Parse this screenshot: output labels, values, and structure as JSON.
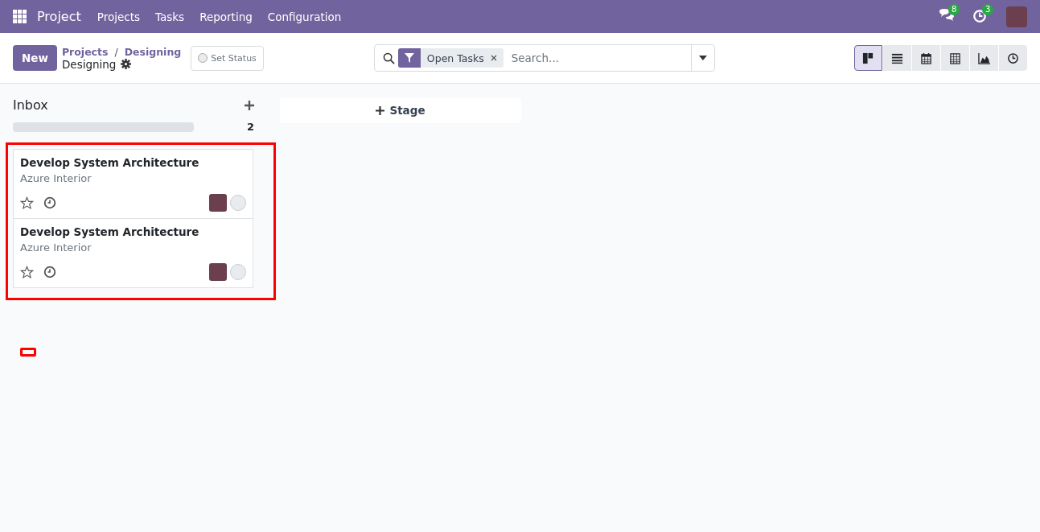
{
  "navbar": {
    "app_name": "Project",
    "menu": [
      "Projects",
      "Tasks",
      "Reporting",
      "Configuration"
    ],
    "messages_count": "8",
    "activities_count": "3"
  },
  "control_panel": {
    "new_button": "New",
    "breadcrumb": [
      "Projects",
      "Designing"
    ],
    "breadcrumb_separator": "/",
    "current": "Designing",
    "status_button": "Set Status",
    "search": {
      "facet": "Open Tasks",
      "placeholder": "Search..."
    },
    "views": [
      {
        "kind": "kanban",
        "selected": true
      },
      {
        "kind": "list",
        "selected": false
      },
      {
        "kind": "calendar",
        "selected": false
      },
      {
        "kind": "pivot",
        "selected": false
      },
      {
        "kind": "graph",
        "selected": false
      },
      {
        "kind": "activity",
        "selected": false
      }
    ]
  },
  "columns": [
    {
      "title": "Inbox",
      "count": "2",
      "level": 0,
      "cards": [
        {
          "title": "Develop System Architecture",
          "customer": "Azure Interior",
          "starred": false
        },
        {
          "title": "Develop System Architecture",
          "customer": "Azure Interior",
          "starred": false
        }
      ]
    }
  ],
  "add_stage": "Stage"
}
